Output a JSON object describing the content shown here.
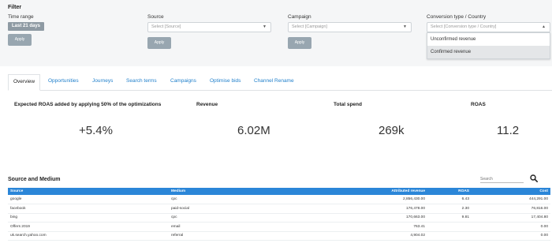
{
  "filter": {
    "title": "Filter",
    "time_range": {
      "label": "Time range",
      "value": "Last 21 days",
      "apply": "Apply"
    },
    "source": {
      "label": "Source",
      "placeholder": "Select [Source]",
      "apply": "Apply"
    },
    "campaign": {
      "label": "Campaign",
      "placeholder": "Select [Campaign]",
      "apply": "Apply"
    },
    "conversion": {
      "label": "Conversion type / Country",
      "placeholder": "Select [Conversion type / Country]",
      "options": [
        "Unconfirmed revenue",
        "Confirmed revenue"
      ],
      "highlighted": "Confirmed revenue"
    }
  },
  "tabs": [
    "Overview",
    "Opportunities",
    "Journeys",
    "Search terms",
    "Campaigns",
    "Optimise bids",
    "Channel Rename"
  ],
  "active_tab": "Overview",
  "kpis": [
    {
      "label": "Expected ROAS added by applying 50% of the optimizations",
      "value": "+5.4%"
    },
    {
      "label": "Revenue",
      "value": "6.02M"
    },
    {
      "label": "Total spend",
      "value": "269k"
    },
    {
      "label": "ROAS",
      "value": "11.2"
    }
  ],
  "source_medium": {
    "title": "Source and Medium",
    "search_placeholder": "Search",
    "columns": [
      "Source",
      "Medium",
      "Attributed revenue",
      "ROAS",
      "Cost"
    ],
    "rows": [
      [
        "google",
        "cpc",
        "2,856,430.00",
        "6.43",
        "444,291.00"
      ],
      [
        "facebook",
        "paid-social",
        "176,478.00",
        "2.30",
        "76,816.00"
      ],
      [
        "bing",
        "cpc",
        "170,663.00",
        "9.81",
        "17,404.80"
      ],
      [
        "Offers 2019",
        "email",
        "763.41",
        "",
        "0.00"
      ],
      [
        "uk.search.yahoo.com",
        "referral",
        "4,904.02",
        "",
        "0.00"
      ]
    ]
  },
  "colors": {
    "header_blue": "#2b86d8",
    "tab_link": "#1f7fcb",
    "panel_bg": "#f5f6f7"
  },
  "icons": {
    "search": "search-icon",
    "caret": "chevron-down-icon"
  }
}
